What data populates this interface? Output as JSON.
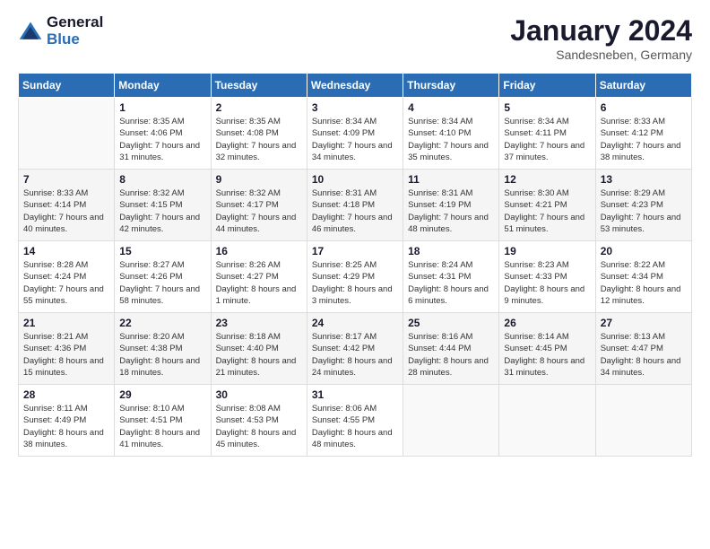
{
  "logo": {
    "general": "General",
    "blue": "Blue"
  },
  "title": "January 2024",
  "location": "Sandesneben, Germany",
  "weekdays": [
    "Sunday",
    "Monday",
    "Tuesday",
    "Wednesday",
    "Thursday",
    "Friday",
    "Saturday"
  ],
  "weeks": [
    [
      {
        "day": "",
        "sunrise": "",
        "sunset": "",
        "daylight": ""
      },
      {
        "day": "1",
        "sunrise": "Sunrise: 8:35 AM",
        "sunset": "Sunset: 4:06 PM",
        "daylight": "Daylight: 7 hours and 31 minutes."
      },
      {
        "day": "2",
        "sunrise": "Sunrise: 8:35 AM",
        "sunset": "Sunset: 4:08 PM",
        "daylight": "Daylight: 7 hours and 32 minutes."
      },
      {
        "day": "3",
        "sunrise": "Sunrise: 8:34 AM",
        "sunset": "Sunset: 4:09 PM",
        "daylight": "Daylight: 7 hours and 34 minutes."
      },
      {
        "day": "4",
        "sunrise": "Sunrise: 8:34 AM",
        "sunset": "Sunset: 4:10 PM",
        "daylight": "Daylight: 7 hours and 35 minutes."
      },
      {
        "day": "5",
        "sunrise": "Sunrise: 8:34 AM",
        "sunset": "Sunset: 4:11 PM",
        "daylight": "Daylight: 7 hours and 37 minutes."
      },
      {
        "day": "6",
        "sunrise": "Sunrise: 8:33 AM",
        "sunset": "Sunset: 4:12 PM",
        "daylight": "Daylight: 7 hours and 38 minutes."
      }
    ],
    [
      {
        "day": "7",
        "sunrise": "Sunrise: 8:33 AM",
        "sunset": "Sunset: 4:14 PM",
        "daylight": "Daylight: 7 hours and 40 minutes."
      },
      {
        "day": "8",
        "sunrise": "Sunrise: 8:32 AM",
        "sunset": "Sunset: 4:15 PM",
        "daylight": "Daylight: 7 hours and 42 minutes."
      },
      {
        "day": "9",
        "sunrise": "Sunrise: 8:32 AM",
        "sunset": "Sunset: 4:17 PM",
        "daylight": "Daylight: 7 hours and 44 minutes."
      },
      {
        "day": "10",
        "sunrise": "Sunrise: 8:31 AM",
        "sunset": "Sunset: 4:18 PM",
        "daylight": "Daylight: 7 hours and 46 minutes."
      },
      {
        "day": "11",
        "sunrise": "Sunrise: 8:31 AM",
        "sunset": "Sunset: 4:19 PM",
        "daylight": "Daylight: 7 hours and 48 minutes."
      },
      {
        "day": "12",
        "sunrise": "Sunrise: 8:30 AM",
        "sunset": "Sunset: 4:21 PM",
        "daylight": "Daylight: 7 hours and 51 minutes."
      },
      {
        "day": "13",
        "sunrise": "Sunrise: 8:29 AM",
        "sunset": "Sunset: 4:23 PM",
        "daylight": "Daylight: 7 hours and 53 minutes."
      }
    ],
    [
      {
        "day": "14",
        "sunrise": "Sunrise: 8:28 AM",
        "sunset": "Sunset: 4:24 PM",
        "daylight": "Daylight: 7 hours and 55 minutes."
      },
      {
        "day": "15",
        "sunrise": "Sunrise: 8:27 AM",
        "sunset": "Sunset: 4:26 PM",
        "daylight": "Daylight: 7 hours and 58 minutes."
      },
      {
        "day": "16",
        "sunrise": "Sunrise: 8:26 AM",
        "sunset": "Sunset: 4:27 PM",
        "daylight": "Daylight: 8 hours and 1 minute."
      },
      {
        "day": "17",
        "sunrise": "Sunrise: 8:25 AM",
        "sunset": "Sunset: 4:29 PM",
        "daylight": "Daylight: 8 hours and 3 minutes."
      },
      {
        "day": "18",
        "sunrise": "Sunrise: 8:24 AM",
        "sunset": "Sunset: 4:31 PM",
        "daylight": "Daylight: 8 hours and 6 minutes."
      },
      {
        "day": "19",
        "sunrise": "Sunrise: 8:23 AM",
        "sunset": "Sunset: 4:33 PM",
        "daylight": "Daylight: 8 hours and 9 minutes."
      },
      {
        "day": "20",
        "sunrise": "Sunrise: 8:22 AM",
        "sunset": "Sunset: 4:34 PM",
        "daylight": "Daylight: 8 hours and 12 minutes."
      }
    ],
    [
      {
        "day": "21",
        "sunrise": "Sunrise: 8:21 AM",
        "sunset": "Sunset: 4:36 PM",
        "daylight": "Daylight: 8 hours and 15 minutes."
      },
      {
        "day": "22",
        "sunrise": "Sunrise: 8:20 AM",
        "sunset": "Sunset: 4:38 PM",
        "daylight": "Daylight: 8 hours and 18 minutes."
      },
      {
        "day": "23",
        "sunrise": "Sunrise: 8:18 AM",
        "sunset": "Sunset: 4:40 PM",
        "daylight": "Daylight: 8 hours and 21 minutes."
      },
      {
        "day": "24",
        "sunrise": "Sunrise: 8:17 AM",
        "sunset": "Sunset: 4:42 PM",
        "daylight": "Daylight: 8 hours and 24 minutes."
      },
      {
        "day": "25",
        "sunrise": "Sunrise: 8:16 AM",
        "sunset": "Sunset: 4:44 PM",
        "daylight": "Daylight: 8 hours and 28 minutes."
      },
      {
        "day": "26",
        "sunrise": "Sunrise: 8:14 AM",
        "sunset": "Sunset: 4:45 PM",
        "daylight": "Daylight: 8 hours and 31 minutes."
      },
      {
        "day": "27",
        "sunrise": "Sunrise: 8:13 AM",
        "sunset": "Sunset: 4:47 PM",
        "daylight": "Daylight: 8 hours and 34 minutes."
      }
    ],
    [
      {
        "day": "28",
        "sunrise": "Sunrise: 8:11 AM",
        "sunset": "Sunset: 4:49 PM",
        "daylight": "Daylight: 8 hours and 38 minutes."
      },
      {
        "day": "29",
        "sunrise": "Sunrise: 8:10 AM",
        "sunset": "Sunset: 4:51 PM",
        "daylight": "Daylight: 8 hours and 41 minutes."
      },
      {
        "day": "30",
        "sunrise": "Sunrise: 8:08 AM",
        "sunset": "Sunset: 4:53 PM",
        "daylight": "Daylight: 8 hours and 45 minutes."
      },
      {
        "day": "31",
        "sunrise": "Sunrise: 8:06 AM",
        "sunset": "Sunset: 4:55 PM",
        "daylight": "Daylight: 8 hours and 48 minutes."
      },
      {
        "day": "",
        "sunrise": "",
        "sunset": "",
        "daylight": ""
      },
      {
        "day": "",
        "sunrise": "",
        "sunset": "",
        "daylight": ""
      },
      {
        "day": "",
        "sunrise": "",
        "sunset": "",
        "daylight": ""
      }
    ]
  ]
}
